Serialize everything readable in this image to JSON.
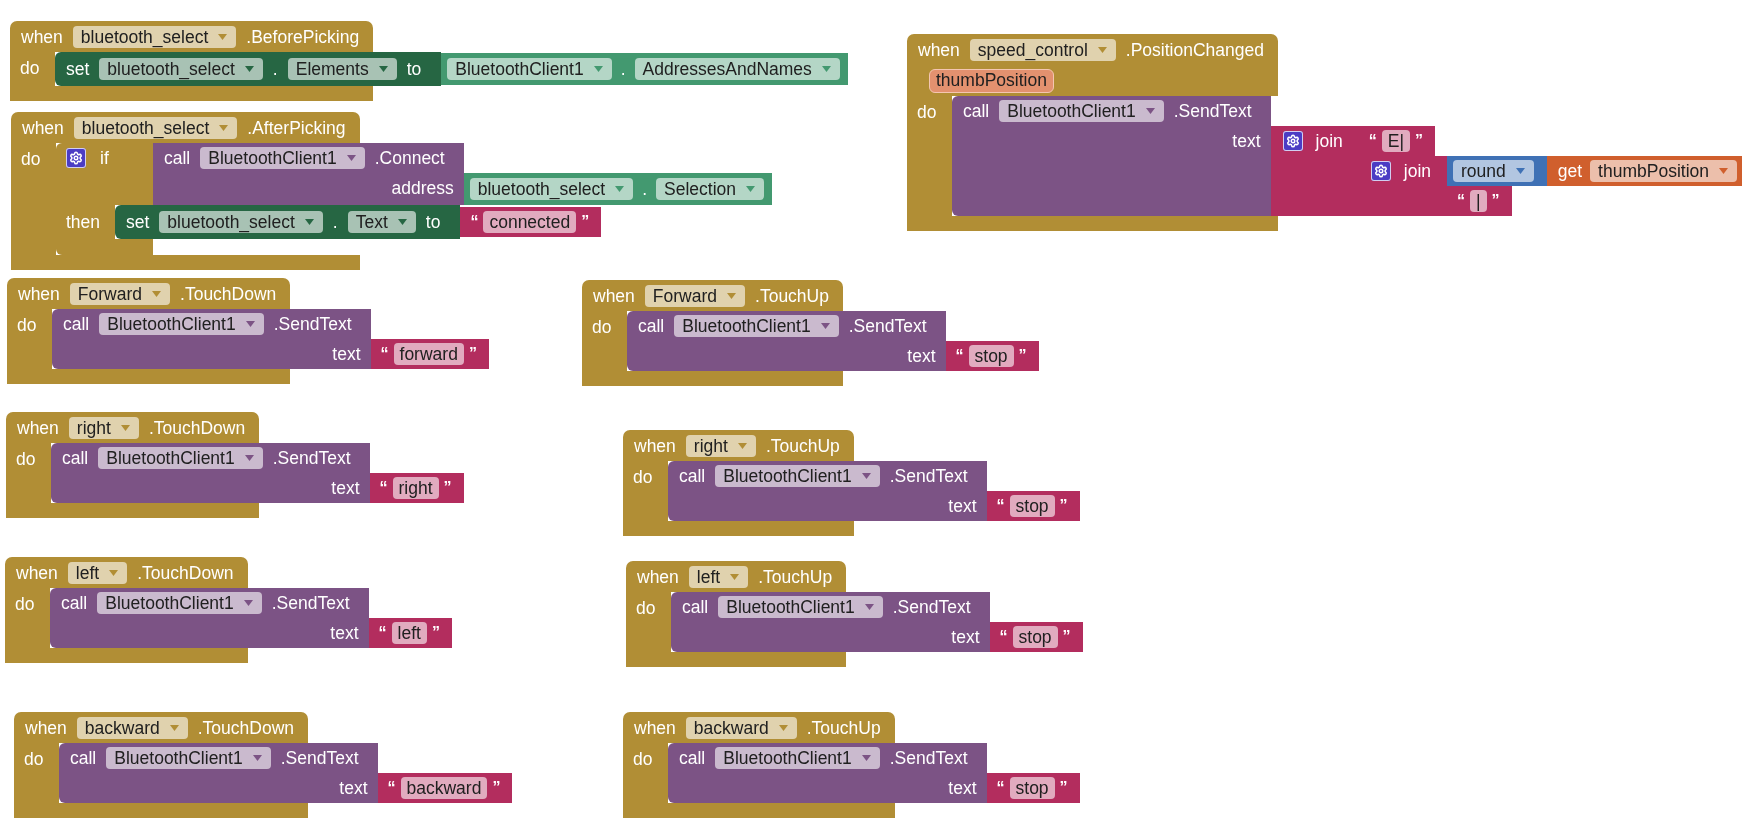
{
  "blocks": [
    {
      "kind": "event",
      "when": "when",
      "component": "bluetooth_select",
      "event": ".BeforePicking",
      "do": "do",
      "body": [
        {
          "kind": "set",
          "keyword": "set",
          "component": "bluetooth_select",
          "dot": ".",
          "property": "Elements",
          "to": "to",
          "value": {
            "kind": "property_get",
            "component": "BluetoothClient1",
            "dot": ".",
            "property": "AddressesAndNames"
          }
        }
      ]
    },
    {
      "kind": "event",
      "when": "when",
      "component": "bluetooth_select",
      "event": ".AfterPicking",
      "do": "do",
      "body": [
        {
          "kind": "if",
          "keyword": "if",
          "condition": {
            "kind": "call",
            "keyword": "call",
            "component": "BluetoothClient1",
            "method": ".Connect",
            "args": [
              {
                "label": "address",
                "value": {
                  "kind": "property_get",
                  "component": "bluetooth_select",
                  "dot": ".",
                  "property": "Selection"
                }
              }
            ]
          },
          "then_label": "then",
          "then": [
            {
              "kind": "set",
              "keyword": "set",
              "component": "bluetooth_select",
              "dot": ".",
              "property": "Text",
              "to": "to",
              "value": {
                "kind": "text",
                "open": "“",
                "value": "connected",
                "close": "”"
              }
            }
          ]
        }
      ]
    },
    {
      "kind": "event",
      "when": "when",
      "component": "speed_control",
      "event": ".PositionChanged",
      "params": [
        "thumbPosition"
      ],
      "do": "do",
      "body": [
        {
          "kind": "call",
          "keyword": "call",
          "component": "BluetoothClient1",
          "method": ".SendText",
          "args": [
            {
              "label": "text",
              "value": {
                "kind": "join",
                "keyword": "join",
                "items": [
                  {
                    "kind": "text",
                    "open": "“",
                    "value": "E|",
                    "close": "”"
                  },
                  {
                    "kind": "join",
                    "keyword": "join",
                    "items": [
                      {
                        "kind": "math",
                        "operator": "round",
                        "arg": {
                          "kind": "get",
                          "keyword": "get",
                          "variable": "thumbPosition"
                        }
                      },
                      {
                        "kind": "text",
                        "open": "“",
                        "value": "|",
                        "close": "”"
                      }
                    ]
                  }
                ]
              }
            }
          ]
        }
      ]
    },
    {
      "kind": "event",
      "when": "when",
      "component": "Forward",
      "event": ".TouchDown",
      "do": "do",
      "body": [
        {
          "kind": "call",
          "keyword": "call",
          "component": "BluetoothClient1",
          "method": ".SendText",
          "args": [
            {
              "label": "text",
              "value": {
                "kind": "text",
                "open": "“",
                "value": "forward",
                "close": "”"
              }
            }
          ]
        }
      ]
    },
    {
      "kind": "event",
      "when": "when",
      "component": "Forward",
      "event": ".TouchUp",
      "do": "do",
      "body": [
        {
          "kind": "call",
          "keyword": "call",
          "component": "BluetoothClient1",
          "method": ".SendText",
          "args": [
            {
              "label": "text",
              "value": {
                "kind": "text",
                "open": "“",
                "value": "stop",
                "close": "”"
              }
            }
          ]
        }
      ]
    },
    {
      "kind": "event",
      "when": "when",
      "component": "right",
      "event": ".TouchDown",
      "do": "do",
      "body": [
        {
          "kind": "call",
          "keyword": "call",
          "component": "BluetoothClient1",
          "method": ".SendText",
          "args": [
            {
              "label": "text",
              "value": {
                "kind": "text",
                "open": "“",
                "value": "right",
                "close": "”"
              }
            }
          ]
        }
      ]
    },
    {
      "kind": "event",
      "when": "when",
      "component": "right",
      "event": ".TouchUp",
      "do": "do",
      "body": [
        {
          "kind": "call",
          "keyword": "call",
          "component": "BluetoothClient1",
          "method": ".SendText",
          "args": [
            {
              "label": "text",
              "value": {
                "kind": "text",
                "open": "“",
                "value": "stop",
                "close": "”"
              }
            }
          ]
        }
      ]
    },
    {
      "kind": "event",
      "when": "when",
      "component": "left",
      "event": ".TouchDown",
      "do": "do",
      "body": [
        {
          "kind": "call",
          "keyword": "call",
          "component": "BluetoothClient1",
          "method": ".SendText",
          "args": [
            {
              "label": "text",
              "value": {
                "kind": "text",
                "open": "“",
                "value": "left",
                "close": "”"
              }
            }
          ]
        }
      ]
    },
    {
      "kind": "event",
      "when": "when",
      "component": "left",
      "event": ".TouchUp",
      "do": "do",
      "body": [
        {
          "kind": "call",
          "keyword": "call",
          "component": "BluetoothClient1",
          "method": ".SendText",
          "args": [
            {
              "label": "text",
              "value": {
                "kind": "text",
                "open": "“",
                "value": "stop",
                "close": "”"
              }
            }
          ]
        }
      ]
    },
    {
      "kind": "event",
      "when": "when",
      "component": "backward",
      "event": ".TouchDown",
      "do": "do",
      "body": [
        {
          "kind": "call",
          "keyword": "call",
          "component": "BluetoothClient1",
          "method": ".SendText",
          "args": [
            {
              "label": "text",
              "value": {
                "kind": "text",
                "open": "“",
                "value": "backward",
                "close": "”"
              }
            }
          ]
        }
      ]
    },
    {
      "kind": "event",
      "when": "when",
      "component": "backward",
      "event": ".TouchUp",
      "do": "do",
      "body": [
        {
          "kind": "call",
          "keyword": "call",
          "component": "BluetoothClient1",
          "method": ".SendText",
          "args": [
            {
              "label": "text",
              "value": {
                "kind": "text",
                "open": "“",
                "value": "stop",
                "close": "”"
              }
            }
          ]
        }
      ]
    }
  ]
}
